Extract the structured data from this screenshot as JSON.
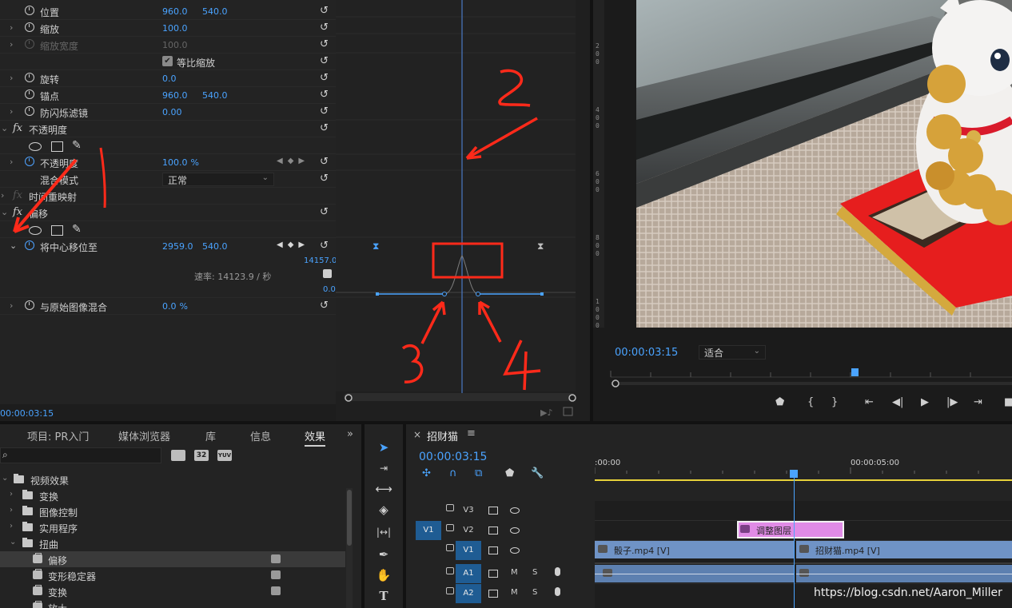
{
  "effect_controls": {
    "rows": [
      {
        "label": "位置",
        "v1": "960.0",
        "v2": "540.0"
      },
      {
        "label": "缩放",
        "v1": "100.0"
      },
      {
        "label": "缩放宽度",
        "v1": "100.0"
      },
      {
        "checkbox_label": "等比缩放"
      },
      {
        "label": "旋转",
        "v1": "0.0"
      },
      {
        "label": "锚点",
        "v1": "960.0",
        "v2": "540.0"
      },
      {
        "label": "防闪烁滤镜",
        "v1": "0.00"
      }
    ],
    "opacity": {
      "section_label": "不透明度",
      "row_label": "不透明度",
      "value": "100.0",
      "unit": "%",
      "blend_label": "混合模式",
      "blend_value": "正常"
    },
    "time_remap_label": "时间重映射",
    "offset": {
      "section_label": "偏移",
      "center_label": "将中心移位至",
      "center_v1": "2959.0",
      "center_v2": "540.0",
      "top_value": "14157.0",
      "velocity_label": "速率: 14123.9 / 秒",
      "bottom_value": "0.0",
      "blend_label": "与原始图像混合",
      "blend_value": "0.0",
      "blend_unit": "%"
    },
    "timecode": "00:00:03:15"
  },
  "program_monitor": {
    "timecode": "00:00:03:15",
    "fit_value": "适合",
    "ruler_marks": [
      "2",
      "0",
      "0",
      "4",
      "0",
      "0",
      "6",
      "0",
      "0",
      "8",
      "0",
      "0",
      "1",
      "0",
      "0",
      "0"
    ]
  },
  "project_panel": {
    "tabs": [
      "项目: PR入门",
      "媒体浏览器",
      "库",
      "信息",
      "效果"
    ],
    "overflow": "»",
    "badges": [
      "32",
      "YUV"
    ],
    "tree": [
      {
        "label": "视频效果",
        "level": 0,
        "type": "folder",
        "open": true
      },
      {
        "label": "变换",
        "level": 1,
        "type": "folder"
      },
      {
        "label": "图像控制",
        "level": 1,
        "type": "folder"
      },
      {
        "label": "实用程序",
        "level": 1,
        "type": "folder"
      },
      {
        "label": "扭曲",
        "level": 1,
        "type": "folder",
        "open": true
      },
      {
        "label": "偏移",
        "level": 2,
        "type": "effect",
        "selected": true
      },
      {
        "label": "变形稳定器",
        "level": 2,
        "type": "effect"
      },
      {
        "label": "变换",
        "level": 2,
        "type": "effect"
      },
      {
        "label": "放大",
        "level": 2,
        "type": "effect"
      }
    ]
  },
  "timeline": {
    "close": "×",
    "sequence_name": "招财猫",
    "menu": "≡",
    "timecode": "00:00:03:15",
    "ruler_left": ":00:00",
    "ruler_mid": "00:00:05:00",
    "tracks": [
      {
        "name": "V3"
      },
      {
        "name": "V2",
        "src": "V1"
      },
      {
        "name": "V1",
        "selected": true
      },
      {
        "name": "A1",
        "selected": true,
        "m": "M",
        "s": "S"
      },
      {
        "name": "A2",
        "selected": true,
        "m": "M",
        "s": "S"
      }
    ],
    "clips": {
      "adjustment": "调整图层",
      "clip1": "骰子.mp4 [V]",
      "clip2": "招财猫.mp4 [V]"
    }
  },
  "annotations": [
    "1",
    "2",
    "3",
    "4"
  ],
  "watermark": "https://blog.csdn.net/Aaron_Miller",
  "colors": {
    "accent_blue": "#4aa3ff",
    "annotation_red": "#ff2a1a",
    "clip_blue": "#6f93c6",
    "adjust_pink": "#e08be6",
    "work_area": "#e6d13a"
  }
}
